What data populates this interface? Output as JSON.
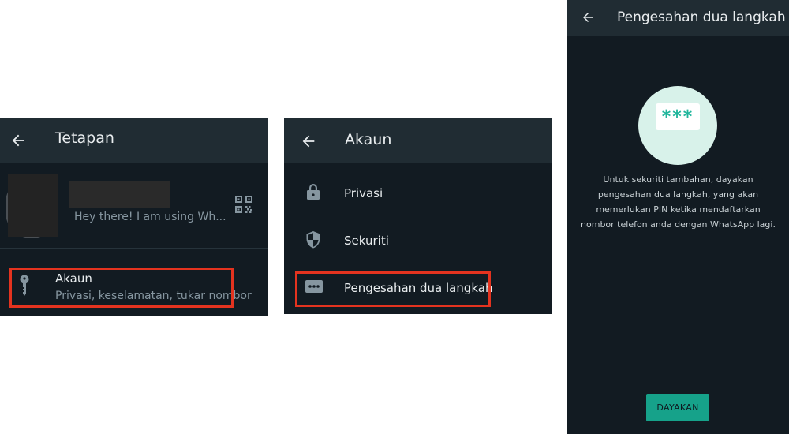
{
  "settings_screen": {
    "title": "Tetapan",
    "profile_status": "Hey there! I am using Wh...",
    "account_item": {
      "title": "Akaun",
      "subtitle": "Privasi, keselamatan, tukar nombor"
    }
  },
  "account_screen": {
    "title": "Akaun",
    "items": [
      {
        "label": "Privasi",
        "icon": "lock-icon"
      },
      {
        "label": "Sekuriti",
        "icon": "shield-icon"
      },
      {
        "label": "Pengesahan dua langkah",
        "icon": "pin-dots-icon"
      }
    ]
  },
  "two_step_screen": {
    "title": "Pengesahan dua langkah",
    "badge_text": "***",
    "description": "Untuk sekuriti tambahan, dayakan pengesahan dua langkah, yang akan memerlukan PIN ketika mendaftarkan nombor telefon anda dengan WhatsApp lagi.",
    "enable_button": "DAYAKAN"
  },
  "colors": {
    "background_dark": "#121b22",
    "header": "#202c33",
    "accent": "#16a28a",
    "highlight_border": "#e4331f"
  }
}
